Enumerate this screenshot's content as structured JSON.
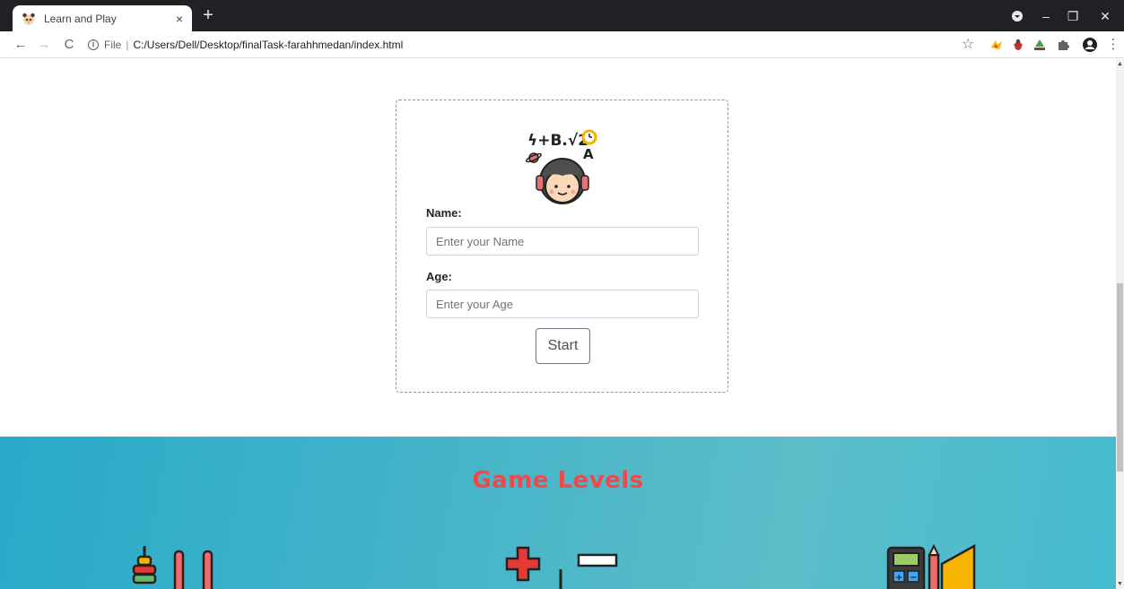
{
  "browser": {
    "tab_title": "Learn and Play",
    "tab_close": "×",
    "new_tab": "+",
    "url_scheme": "File",
    "url_sep": "|",
    "url_path": "C:/Users/Dell/Desktop/finalTask-farahhmedan/index.html",
    "nav": {
      "back": "←",
      "forward": "→",
      "reload": "C"
    },
    "window": {
      "minimize": "–",
      "restore": "❐",
      "close": "✕"
    },
    "star": "☆",
    "menu": "⋮"
  },
  "form": {
    "name_label": "Name:",
    "name_placeholder": "Enter your Name",
    "age_label": "Age:",
    "age_placeholder": "Enter your Age",
    "start_label": "Start"
  },
  "levels": {
    "title": "Game Levels",
    "icons": [
      "abacus-icon",
      "math-operators-icon",
      "calculator-ruler-icon"
    ]
  },
  "colors": {
    "accent_red": "#ef4a4a",
    "levels_bg": "#45b4c9",
    "card_border": "#e57373"
  }
}
